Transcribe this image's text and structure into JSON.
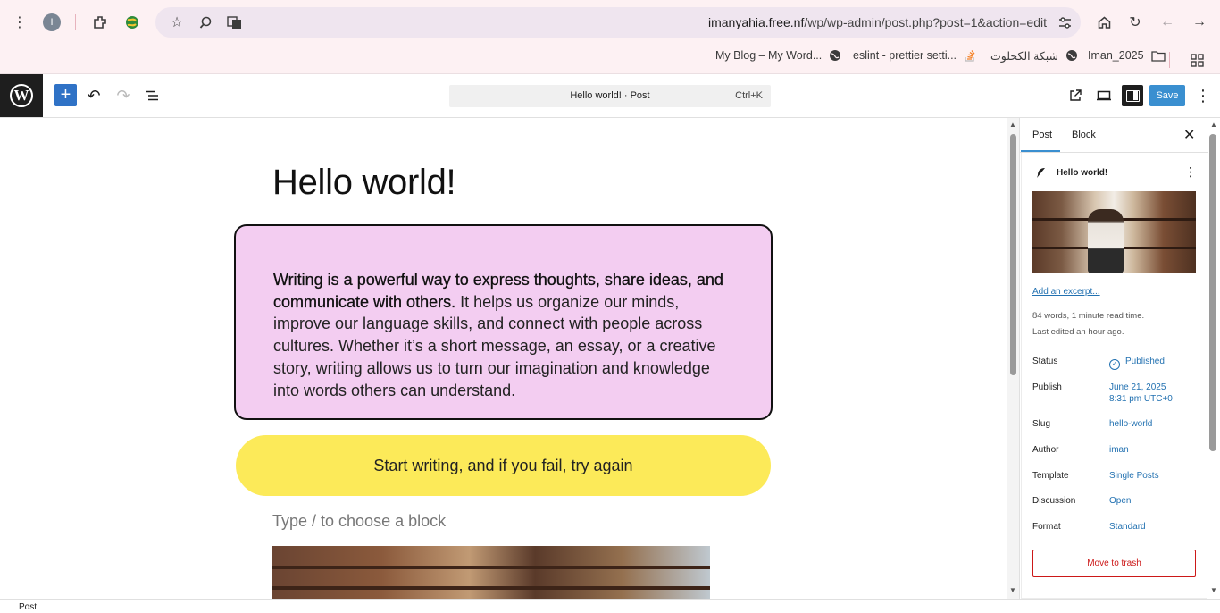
{
  "browser": {
    "profile_initial": "I",
    "url_host": "imanyahia.free.nf",
    "url_path": "/wp/wp-admin/post.php?post=1&action=edit",
    "bookmarks": [
      {
        "label": "My Blog – My Word...",
        "icon": "globe-icon"
      },
      {
        "label": "eslint - prettier setti...",
        "icon": "stackoverflow-icon"
      },
      {
        "label": "شبكة الكحلوت",
        "icon": "globe-icon"
      },
      {
        "label": "Iman_2025",
        "icon": "folder-icon"
      }
    ]
  },
  "toolbar": {
    "command_title": "Hello world! · Post",
    "command_shortcut": "Ctrl+K",
    "save_label": "Save",
    "accent": "#2f72c6"
  },
  "canvas": {
    "title": "Hello world!",
    "paragraph_bold": "Writing is a powerful way to express thoughts, share ideas, and communicate with others.",
    "paragraph_rest": " It helps us organize our minds, improve our language skills, and connect with people across cultures. Whether it’s a short message, an essay, or a creative story, writing allows us to turn our imagination and knowledge into words others can understand.",
    "button_text": "Start writing, and if you fail, try again",
    "block_placeholder": "Type / to choose a block",
    "pink_bg": "#f3cdf1",
    "yellow_bg": "#fcea59"
  },
  "sidebar": {
    "tabs": [
      "Post",
      "Block"
    ],
    "post_title": "Hello world!",
    "excerpt_link": "Add an excerpt...",
    "word_count": "84 words, 1 minute read time.",
    "last_edited": "Last edited an hour ago.",
    "rows": [
      {
        "label": "Status",
        "value": "Published"
      },
      {
        "label": "Publish",
        "value": "June 21, 2025",
        "value2": "8:31 pm UTC+0"
      },
      {
        "label": "Slug",
        "value": "hello-world"
      },
      {
        "label": "Author",
        "value": "iman"
      },
      {
        "label": "Template",
        "value": "Single Posts"
      },
      {
        "label": "Discussion",
        "value": "Open"
      },
      {
        "label": "Format",
        "value": "Standard"
      }
    ],
    "trash_label": "Move to trash"
  },
  "footer": {
    "breadcrumb": "Post"
  }
}
